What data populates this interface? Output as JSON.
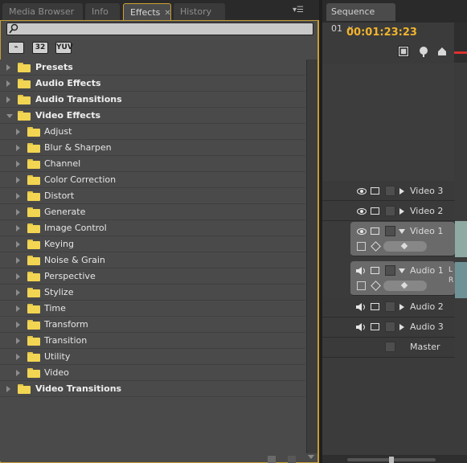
{
  "left_tabs": [
    {
      "label": "Media Browser"
    },
    {
      "label": "Info"
    },
    {
      "label": "Effects",
      "active": true
    },
    {
      "label": "History"
    }
  ],
  "toolbar": {
    "btn_accel": "⌁",
    "btn_32": "32",
    "btn_yuv": "YUV"
  },
  "effects_tree": [
    {
      "label": "Presets",
      "bold": true,
      "depth": 0,
      "open": false
    },
    {
      "label": "Audio Effects",
      "bold": true,
      "depth": 0,
      "open": false
    },
    {
      "label": "Audio Transitions",
      "bold": true,
      "depth": 0,
      "open": false
    },
    {
      "label": "Video Effects",
      "bold": true,
      "depth": 0,
      "open": true
    },
    {
      "label": "Adjust",
      "bold": false,
      "depth": 1,
      "open": false
    },
    {
      "label": "Blur & Sharpen",
      "bold": false,
      "depth": 1,
      "open": false
    },
    {
      "label": "Channel",
      "bold": false,
      "depth": 1,
      "open": false
    },
    {
      "label": "Color Correction",
      "bold": false,
      "depth": 1,
      "open": false
    },
    {
      "label": "Distort",
      "bold": false,
      "depth": 1,
      "open": false
    },
    {
      "label": "Generate",
      "bold": false,
      "depth": 1,
      "open": false
    },
    {
      "label": "Image Control",
      "bold": false,
      "depth": 1,
      "open": false
    },
    {
      "label": "Keying",
      "bold": false,
      "depth": 1,
      "open": false
    },
    {
      "label": "Noise & Grain",
      "bold": false,
      "depth": 1,
      "open": false
    },
    {
      "label": "Perspective",
      "bold": false,
      "depth": 1,
      "open": false
    },
    {
      "label": "Stylize",
      "bold": false,
      "depth": 1,
      "open": false
    },
    {
      "label": "Time",
      "bold": false,
      "depth": 1,
      "open": false
    },
    {
      "label": "Transform",
      "bold": false,
      "depth": 1,
      "open": false
    },
    {
      "label": "Transition",
      "bold": false,
      "depth": 1,
      "open": false
    },
    {
      "label": "Utility",
      "bold": false,
      "depth": 1,
      "open": false
    },
    {
      "label": "Video",
      "bold": false,
      "depth": 1,
      "open": false
    },
    {
      "label": "Video Transitions",
      "bold": true,
      "depth": 0,
      "open": false
    }
  ],
  "sequence": {
    "tab_label": "Sequence 01",
    "timecode": "00:01:23:23",
    "tracks": {
      "video3": "Video 3",
      "video2": "Video 2",
      "video1": "Video 1",
      "audio1": "Audio 1",
      "audio2": "Audio 2",
      "audio3": "Audio 3",
      "master": "Master"
    },
    "edge_letters": [
      "L",
      "R"
    ]
  },
  "colors": {
    "accent": "#cda234",
    "timecode": "#f2b42b",
    "folder": "#f2d553"
  }
}
